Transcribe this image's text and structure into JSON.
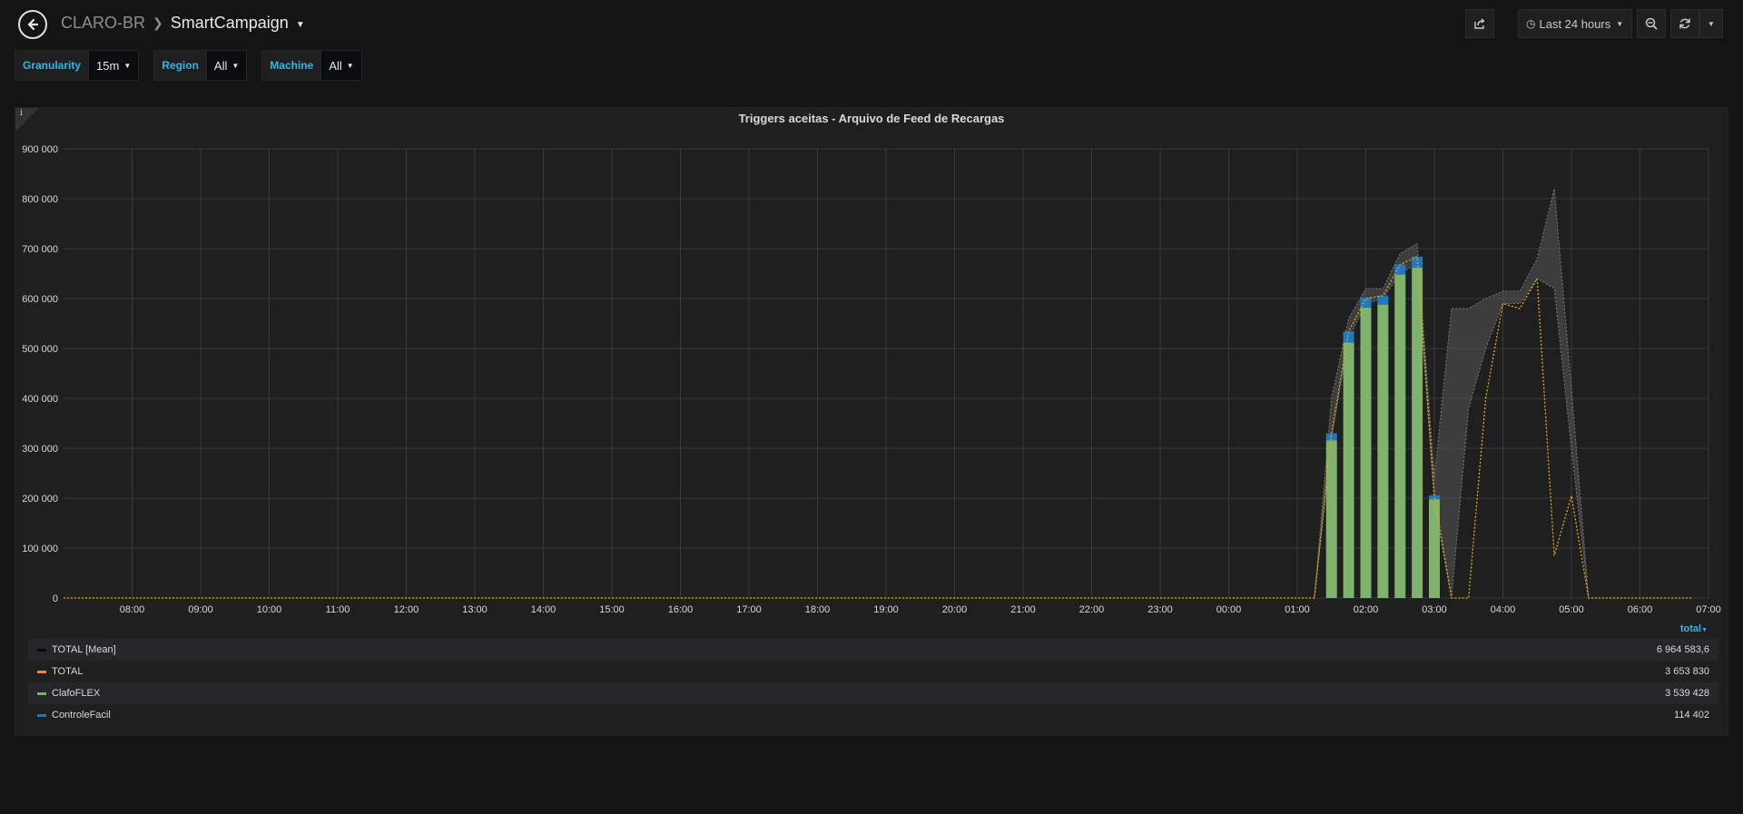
{
  "breadcrumb": {
    "folder": "CLARO-BR",
    "dashboard": "SmartCampaign"
  },
  "timepicker": {
    "label": "Last 24 hours"
  },
  "variables": [
    {
      "label": "Granularity",
      "value": "15m"
    },
    {
      "label": "Region",
      "value": "All"
    },
    {
      "label": "Machine",
      "value": "All"
    }
  ],
  "panel": {
    "title": "Triggers aceitas - Arquivo de Feed de Recargas",
    "info_icon": "i"
  },
  "legend": {
    "sort_label": "total",
    "items": [
      {
        "name": "TOTAL [Mean]",
        "value": "6 964 583,6",
        "color": "#0a0a0a"
      },
      {
        "name": "TOTAL",
        "value": "3 653 830",
        "color": "#ef843c"
      },
      {
        "name": "ClafoFLEX",
        "value": "3 539 428",
        "color": "#7eb26d"
      },
      {
        "name": "ControleFacil",
        "value": "114 402",
        "color": "#1f78c1"
      }
    ]
  },
  "chart_data": {
    "type": "bar",
    "title": "Triggers aceitas - Arquivo de Feed de Recargas",
    "x_ticks": [
      "08:00",
      "09:00",
      "10:00",
      "11:00",
      "12:00",
      "13:00",
      "14:00",
      "15:00",
      "16:00",
      "17:00",
      "18:00",
      "19:00",
      "20:00",
      "21:00",
      "22:00",
      "23:00",
      "00:00",
      "01:00",
      "02:00",
      "03:00",
      "04:00",
      "05:00",
      "06:00",
      "07:00"
    ],
    "y_ticks": [
      "0",
      "100 000",
      "200 000",
      "300 000",
      "400 000",
      "500 000",
      "600 000",
      "700 000",
      "800 000",
      "900 000"
    ],
    "ylim": [
      0,
      900000
    ],
    "xlim": [
      "07:00",
      "07:00"
    ],
    "grid": true,
    "legend_position": "bottom",
    "bars": {
      "times": [
        "01:30",
        "01:45",
        "02:00",
        "02:15",
        "02:30",
        "02:45",
        "03:00"
      ],
      "series": [
        {
          "name": "ClafoFLEX",
          "color": "#7eb26d",
          "values": [
            316000,
            512000,
            582000,
            588000,
            648000,
            662000,
            198000
          ]
        },
        {
          "name": "ControleFacil",
          "color": "#1f78c1",
          "values": [
            14000,
            22000,
            20000,
            18000,
            20000,
            22000,
            8000
          ]
        }
      ]
    },
    "total_line": {
      "name": "TOTAL",
      "color": "#e5ac0e",
      "points": [
        [
          "07:00",
          0
        ],
        [
          "01:15",
          0
        ],
        [
          "01:30",
          330000
        ],
        [
          "01:45",
          534000
        ],
        [
          "02:00",
          600000
        ],
        [
          "02:15",
          606000
        ],
        [
          "02:30",
          668000
        ],
        [
          "02:45",
          684000
        ],
        [
          "03:00",
          206000
        ],
        [
          "03:15",
          0
        ],
        [
          "03:30",
          0
        ],
        [
          "03:45",
          400000
        ],
        [
          "04:00",
          590000
        ],
        [
          "04:15",
          580000
        ],
        [
          "04:30",
          640000
        ],
        [
          "04:45",
          85000
        ],
        [
          "05:00",
          205000
        ],
        [
          "05:15",
          0
        ],
        [
          "06:45",
          0
        ]
      ]
    },
    "mean_band": {
      "name": "TOTAL [Mean]",
      "color": "#555555",
      "upper": [
        [
          "01:15",
          0
        ],
        [
          "01:30",
          400000
        ],
        [
          "01:45",
          560000
        ],
        [
          "02:00",
          620000
        ],
        [
          "02:15",
          620000
        ],
        [
          "02:30",
          690000
        ],
        [
          "02:45",
          710000
        ],
        [
          "03:00",
          240000
        ],
        [
          "03:15",
          580000
        ],
        [
          "03:30",
          580000
        ],
        [
          "03:45",
          600000
        ],
        [
          "04:00",
          615000
        ],
        [
          "04:15",
          615000
        ],
        [
          "04:30",
          680000
        ],
        [
          "04:45",
          820000
        ],
        [
          "05:00",
          420000
        ],
        [
          "05:15",
          0
        ]
      ],
      "lower": [
        [
          "01:15",
          0
        ],
        [
          "01:30",
          320000
        ],
        [
          "01:45",
          520000
        ],
        [
          "02:00",
          590000
        ],
        [
          "02:15",
          600000
        ],
        [
          "02:30",
          650000
        ],
        [
          "02:45",
          670000
        ],
        [
          "03:00",
          190000
        ],
        [
          "03:15",
          0
        ],
        [
          "03:30",
          380000
        ],
        [
          "03:45",
          500000
        ],
        [
          "04:00",
          590000
        ],
        [
          "04:15",
          590000
        ],
        [
          "04:30",
          640000
        ],
        [
          "04:45",
          620000
        ],
        [
          "05:00",
          300000
        ],
        [
          "05:15",
          0
        ]
      ]
    }
  }
}
